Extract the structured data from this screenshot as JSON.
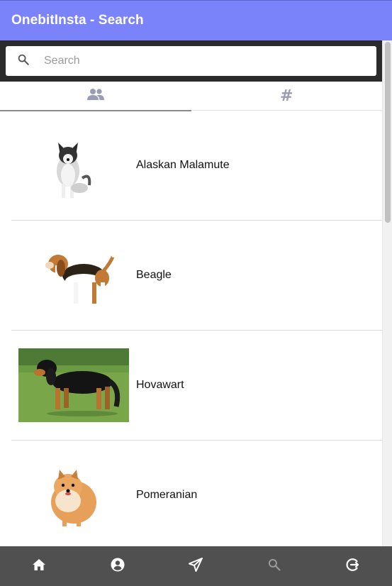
{
  "app": {
    "title": "OnebitInsta - Search"
  },
  "search": {
    "placeholder": "Search",
    "value": ""
  },
  "tabs": [
    {
      "id": "users",
      "icon": "people-icon",
      "active": true
    },
    {
      "id": "hashtags",
      "icon": "hash-icon",
      "symbol": "#",
      "active": false
    }
  ],
  "results": [
    {
      "name": "Alaskan Malamute",
      "image": "alaskan-malamute-photo"
    },
    {
      "name": "Beagle",
      "image": "beagle-photo"
    },
    {
      "name": "Hovawart",
      "image": "hovawart-photo"
    },
    {
      "name": "Pomeranian",
      "image": "pomeranian-photo"
    }
  ],
  "bottom_nav": [
    {
      "icon": "home-icon",
      "active": false
    },
    {
      "icon": "account-circle-icon",
      "active": false
    },
    {
      "icon": "send-icon",
      "active": false
    },
    {
      "icon": "search-icon",
      "active": true
    },
    {
      "icon": "logout-icon",
      "active": false
    }
  ],
  "colors": {
    "header": "#7b83fb",
    "search_bar": "#2b2b2b",
    "bottom_nav": "#505050",
    "nav_icon": "#ffffff",
    "nav_icon_active": "#9a9a9a",
    "tab_icon": "#9a9cb3"
  }
}
